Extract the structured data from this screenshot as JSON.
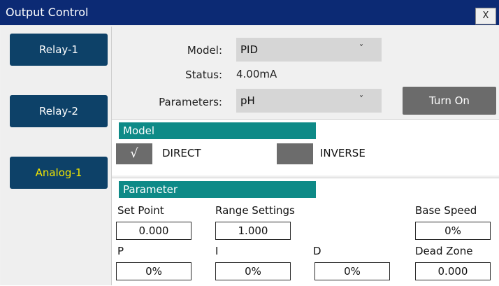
{
  "window": {
    "title": "Output Control",
    "close_label": "X"
  },
  "sidebar": {
    "items": [
      {
        "label": "Relay-1"
      },
      {
        "label": "Relay-2"
      },
      {
        "label": "Analog-1"
      }
    ]
  },
  "form": {
    "model_label": "Model:",
    "model_value": "PID",
    "status_label": "Status:",
    "status_value": "4.00mA",
    "parameters_label": "Parameters:",
    "parameters_value": "pH",
    "turn_on_label": "Turn On"
  },
  "model_section": {
    "title": "Model",
    "options": [
      {
        "label": "DIRECT",
        "checked": true,
        "check_glyph": "√"
      },
      {
        "label": "INVERSE",
        "checked": false
      }
    ]
  },
  "parameter_section": {
    "title": "Parameter",
    "set_point": {
      "label": "Set Point",
      "value": "0.000"
    },
    "range_settings": {
      "label": "Range Settings",
      "value": "1.000"
    },
    "base_speed": {
      "label": "Base Speed",
      "value": "0%"
    },
    "p": {
      "label": "P",
      "value": "0%"
    },
    "i": {
      "label": "I",
      "value": "0%"
    },
    "d": {
      "label": "D",
      "value": "0%"
    },
    "dead_zone": {
      "label": "Dead Zone",
      "value": "0.000"
    }
  },
  "colors": {
    "title_bar": "#0c2a74",
    "nav_button": "#0d4168",
    "nav_active_text": "#f2e600",
    "section_header": "#0e8a87",
    "turn_on_button": "#6b6b6b"
  },
  "icons": {
    "dropdown": "chevron-down-icon",
    "close": "close-icon",
    "check": "check-icon"
  }
}
